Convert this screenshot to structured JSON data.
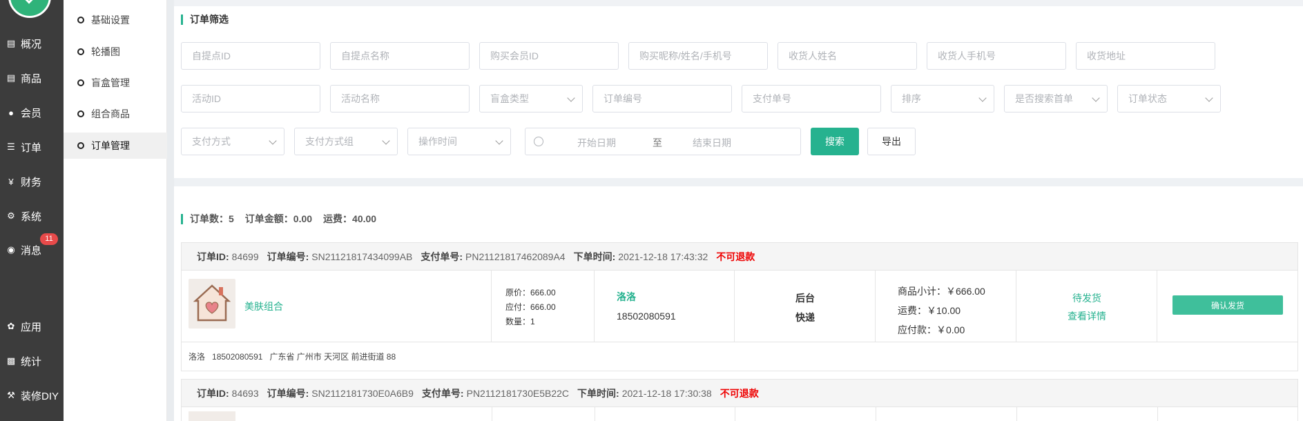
{
  "nav": {
    "items": [
      {
        "label": "概况",
        "icon": "doc-icon"
      },
      {
        "label": "商品",
        "icon": "doc-icon"
      },
      {
        "label": "会员",
        "icon": "users-icon"
      },
      {
        "label": "订单",
        "icon": "cart-icon"
      },
      {
        "label": "财务",
        "icon": "yen-icon"
      },
      {
        "label": "系统",
        "icon": "gear-icon"
      },
      {
        "label": "消息",
        "icon": "chat-icon"
      },
      {
        "label": "应用",
        "icon": "apps-icon"
      },
      {
        "label": "统计",
        "icon": "chart-icon"
      },
      {
        "label": "装修DIY",
        "icon": "hammer-icon"
      }
    ],
    "message_badge": "11"
  },
  "submenu": {
    "items": [
      {
        "label": "基础设置"
      },
      {
        "label": "轮播图"
      },
      {
        "label": "盲盒管理"
      },
      {
        "label": "组合商品"
      },
      {
        "label": "订单管理",
        "active": true
      }
    ]
  },
  "filter": {
    "title": "订单筛选",
    "row1": [
      "自提点ID",
      "自提点名称",
      "购买会员ID",
      "购买昵称/姓名/手机号",
      "收货人姓名",
      "收货人手机号",
      "收货地址"
    ],
    "row2_activity_id": "活动ID",
    "row2_activity_name": "活动名称",
    "row2_blindbox_type": "盲盒类型",
    "row2_order_no": "订单编号",
    "row2_pay_no": "支付单号",
    "row2_sort": "排序",
    "row2_first_order": "是否搜索首单",
    "row2_order_status": "订单状态",
    "row3_pay_method": "支付方式",
    "row3_pay_group": "支付方式组",
    "row3_op_time": "操作时间",
    "row3_start_date": "开始日期",
    "row3_range_sep": "至",
    "row3_end_date": "结束日期",
    "search_button": "搜索",
    "export_button": "导出"
  },
  "summary": {
    "order_count": "订单数：5",
    "order_amount": "订单金额：0.00",
    "freight": "运费：40.00"
  },
  "orders": [
    {
      "id_label": "订单ID:",
      "id": "84699",
      "no_label": "订单编号:",
      "no": "SN21121817434099AB",
      "pay_label": "支付单号:",
      "pay_no": "PN21121817462089A4",
      "time_label": "下单时间:",
      "time": "2021-12-18 17:43:32",
      "refund": "不可退款",
      "product_name": "美肤组合",
      "orig_price": "原价：666.00",
      "payable": "应付：666.00",
      "qty": "数量：1",
      "buyer_name": "洛洛",
      "buyer_phone": "18502080591",
      "source": "后台",
      "delivery": "快递",
      "subtotal": "商品小计：￥666.00",
      "ship_fee": "运费：￥10.00",
      "due": "应付款：￥0.00",
      "status": "待发货",
      "detail_link": "查看详情",
      "action_button": "确认发货",
      "foot_name": "洛洛",
      "foot_phone": "18502080591",
      "foot_address": "广东省 广州市 天河区 前进街道 88"
    },
    {
      "id_label": "订单ID:",
      "id": "84693",
      "no_label": "订单编号:",
      "no": "SN2112181730E0A6B9",
      "pay_label": "支付单号:",
      "pay_no": "PN2112181730E5B22C",
      "time_label": "下单时间:",
      "time": "2021-12-18 17:30:38",
      "refund": "不可退款"
    }
  ]
}
